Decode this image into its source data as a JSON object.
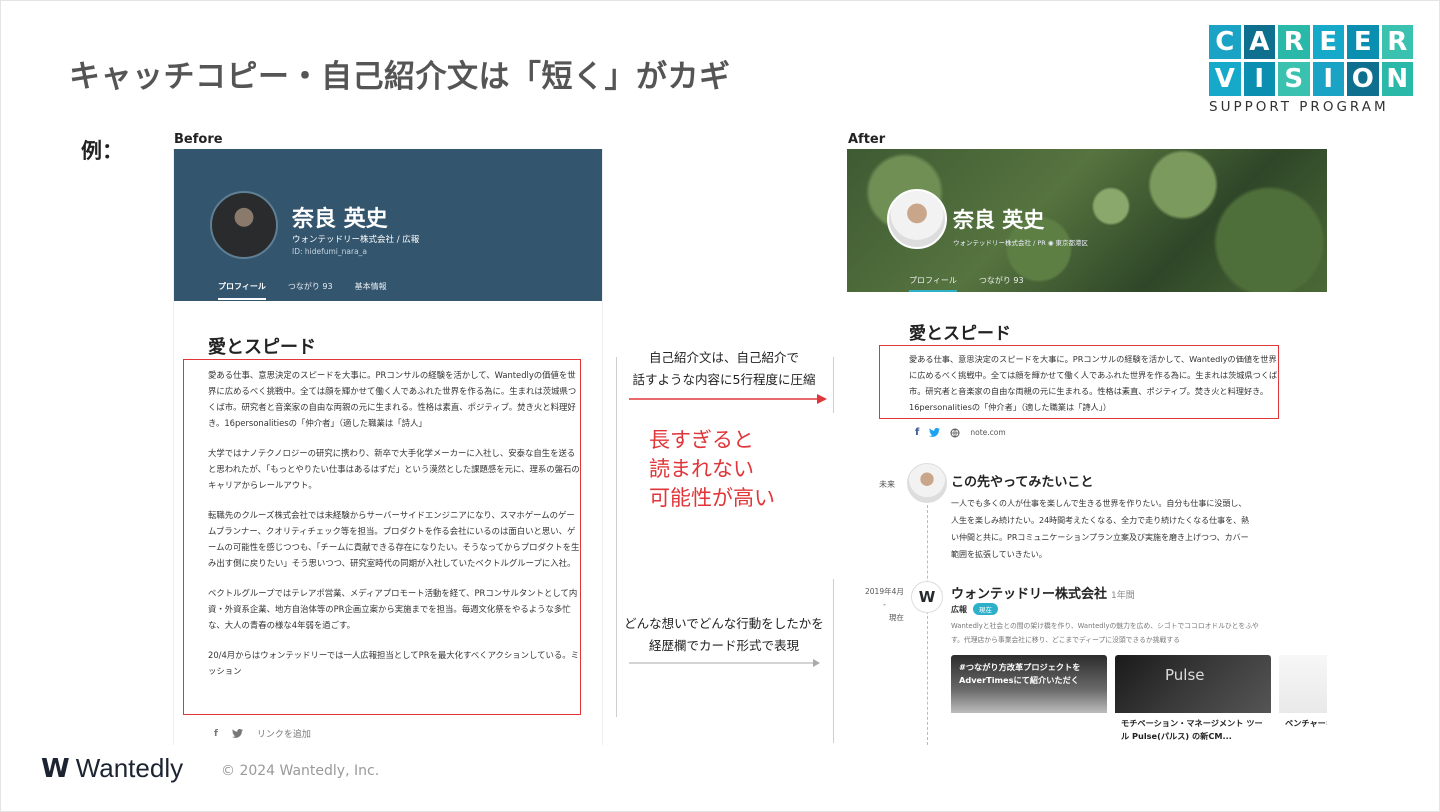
{
  "slide": {
    "title": "キャッチコピー・自己紹介文は「短く」がカギ",
    "example_label": "例：",
    "footer_copyright": "© 2024 Wantedly, Inc.",
    "footer_logo_mark": "W",
    "footer_logo_word": "Wantedly",
    "brand_logo": {
      "line1": [
        "C",
        "A",
        "R",
        "E",
        "E",
        "R"
      ],
      "line2": [
        "V",
        "I",
        "S",
        "I",
        "O",
        "N"
      ],
      "subtitle": "SUPPORT PROGRAM",
      "colors": [
        "#1aa3c4",
        "#0f6f8f",
        "#2ab8a8",
        "#17a9c9",
        "#0b8fb0",
        "#3bc1b0"
      ]
    }
  },
  "before": {
    "label": "Before",
    "name": "奈良 英史",
    "company": "ウォンテッドリー株式会社 / 広報",
    "user_id": "ID: hidefumi_nara_a",
    "tabs": [
      "プロフィール",
      "つながり 93",
      "基本情報"
    ],
    "heading": "愛とスピード",
    "paragraphs": [
      "愛ある仕事、意思決定のスピードを大事に。PRコンサルの経験を活かして、Wantedlyの価値を世界に広めるべく挑戦中。全ては顔を輝かせて働く人であふれた世界を作る為に。生まれは茨城県つくば市。研究者と音楽家の自由な両親の元に生まれる。性格は素直、ポジティブ。焚き火と料理好き。16personalitiesの「仲介者」（適した職業は「詩人」",
      "大学ではナノテクノロジーの研究に携わり、新卒で大手化学メーカーに入社し、安泰な自生を送ると思われたが、「もっとやりたい仕事はあるはずだ」という漠然とした課題感を元に、理系の盤石のキャリアからレールアウト。",
      "転職先のクルーズ株式会社では未経験からサーバーサイドエンジニアになり、スマホゲームのゲームプランナー、クオリティチェック等を担当。プロダクトを作る会社にいるのは面白いと思い、ゲームの可能性を感じつつも、「チームに貢献できる存在になりたい。そうなってからプロダクトを生み出す側に戻りたい」そう思いつつ、研究室時代の同期が入社していたベクトルグループに入社。",
      "ベクトルグループではテレアポ営業、メディアプロモート活動を経て、PRコンサルタントとして内資・外資系企業、地方自治体等のPR企画立案から実施までを担当。毎週文化祭をやるような多忙な、大人の青春の様な4年弱を過ごす。",
      "20/4月からはウォンテッドリーでは一人広報担当としてPRを最大化すべくアクションしている。ミッション"
    ],
    "social_link": "リンクを追加"
  },
  "middle": {
    "top_line1": "自己紹介文は、自己紹介で",
    "top_line2": "話すような内容に5行程度に圧縮",
    "warning_lines": [
      "長すぎると",
      "読まれない",
      "可能性が高い"
    ],
    "bottom_line1": "どんな想いでどんな行動をしたかを",
    "bottom_line2": "経歴欄でカード形式で表現"
  },
  "after": {
    "label": "After",
    "name": "奈良 英史",
    "company": "ウォンテッドリー株式会社 / PR  ◉ 東京都港区",
    "tabs": [
      "プロフィール",
      "つながり 93"
    ],
    "heading": "愛とスピード",
    "intro": "愛ある仕事、意思決定のスピードを大事に。PRコンサルの経験を活かして、Wantedlyの価値を世界に広めるべく挑戦中。全ては顔を輝かせて働く人であふれた世界を作る為に。生まれは茨城県つくば市。研究者と音楽家の自由な両親の元に生まれる。性格は素直、ポジティブ。焚き火と料理好き。16personalitiesの「仲介者」（適した職業は「詩人」）",
    "social_site": "note.com",
    "future_label": "未来",
    "future_title": "この先やってみたいこと",
    "future_body": "一人でも多くの人が仕事を楽しんで生きる世界を作りたい。自分も仕事に没頭し、人生を楽しみ続けたい。24時間考えたくなる、全力で走り続けたくなる仕事を、熱い仲間と共に。PRコミュニケーションプラン立案及び実施を磨き上げつつ、カバー範囲を拡張していきたい。",
    "date_start": "2019年4月",
    "date_sep": "-",
    "date_end": "現在",
    "company_title": "ウォンテッドリー株式会社",
    "company_suffix": "1年間",
    "role": "広報",
    "role_badge": "現在",
    "company_desc": "Wantedlyと社会との間の架け橋を作り、Wantedlyの魅力を広め、シゴトでココロオドルひとをふやす。代理店から事業会社に移り、どこまでディープに没頭できるか挑戦する",
    "cards": [
      {
        "overlay": "#つながり方改革プロジェクトを AdverTimesにて紹介いただく",
        "caption": ""
      },
      {
        "overlay": "Pulse",
        "caption": "モチベーション・マネージメント ツール Pulse(パルス) の新CM..."
      },
      {
        "overlay": "",
        "caption": "ベンチャーキャピ レーターと提携"
      }
    ]
  }
}
